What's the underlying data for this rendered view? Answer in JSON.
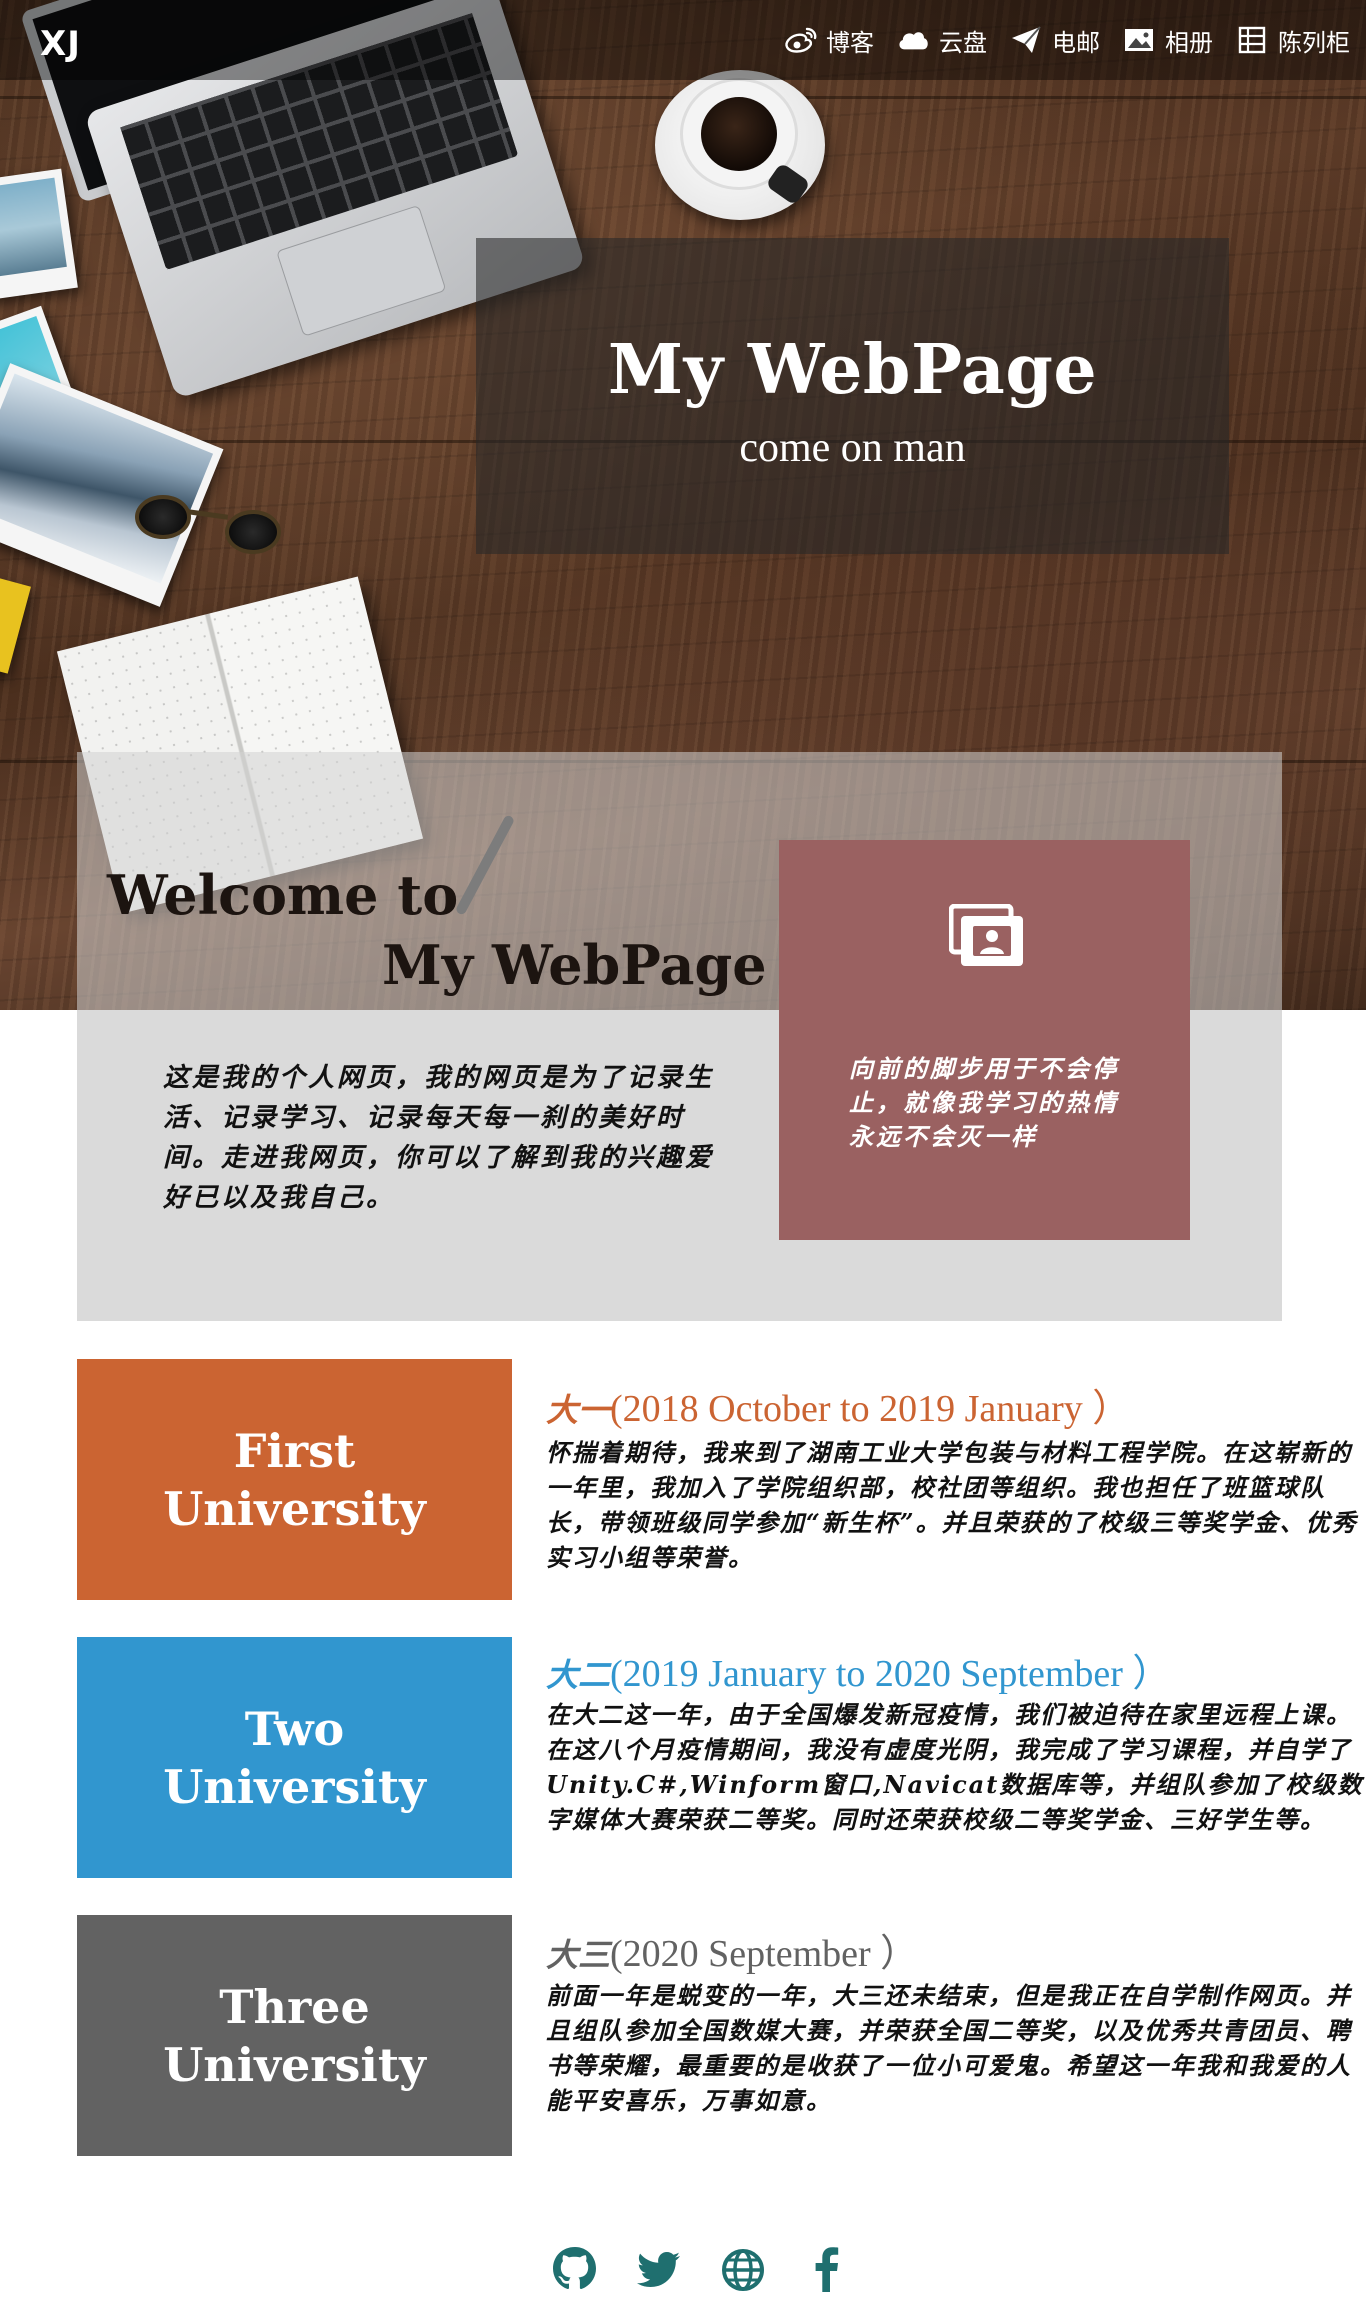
{
  "nav": {
    "brand": "XJ",
    "items": [
      {
        "label": "博客",
        "icon": "weibo-icon"
      },
      {
        "label": "云盘",
        "icon": "cloud-icon"
      },
      {
        "label": "电邮",
        "icon": "send-icon"
      },
      {
        "label": "相册",
        "icon": "picture-icon"
      },
      {
        "label": "陈列柜",
        "icon": "list-icon"
      }
    ]
  },
  "hero": {
    "title": "My WebPage",
    "subtitle": "come on man"
  },
  "about": {
    "welcome_line1": "Welcome to",
    "welcome_line2": "My WebPage",
    "text": "这是我的个人网页，我的网页是为了记录生活、记录学习、记录每天每一刹的美好时间。走进我网页，你可以了解到我的兴趣爱好已以及我自己。",
    "motto_icon": "gallery-icon",
    "motto": "向前的脚步用于不会停止，就像我学习的热情永远不会灭一样"
  },
  "timeline": [
    {
      "block_line1": "First",
      "block_line2": "University",
      "head_cn": "大一",
      "head_en": "(2018 October to 2019 January ）",
      "color": "#cb6432",
      "text": "怀揣着期待，我来到了湖南工业大学包装与材料工程学院。在这崭新的一年里，我加入了学院组织部，校社团等组织。我也担任了班篮球队长，带领班级同学参加“新生杯”。并且荣获的了校级三等奖学金、优秀实习小组等荣誉。"
    },
    {
      "block_line1": "Two",
      "block_line2": "University",
      "head_cn": "大二",
      "head_en": "(2019 January to 2020 September ）",
      "color": "#3196cf",
      "text": "在大二这一年，由于全国爆发新冠疫情，我们被迫待在家里远程上课。在这八个月疫情期间，我没有虚度光阴，我完成了学习课程，并自学了Unity.C#,Winform窗口,Navicat数据库等，并组队参加了校级数字媒体大赛荣获二等奖。同时还荣获校级二等奖学金、三好学生等。"
    },
    {
      "block_line1": "Three",
      "block_line2": "University",
      "head_cn": "大三",
      "head_en": "(2020 September ）",
      "color": "#626262",
      "text": "前面一年是蜕变的一年，大三还未结束，但是我正在自学制作网页。并且组队参加全国数媒大赛，并荣获全国二等奖，以及优秀共青团员、聘书等荣耀，最重要的是收获了一位小可爱鬼。希望这一年我和我爱的人能平安喜乐，万事如意。"
    }
  ],
  "social": [
    "github-icon",
    "twitter-icon",
    "globe-icon",
    "facebook-icon"
  ]
}
